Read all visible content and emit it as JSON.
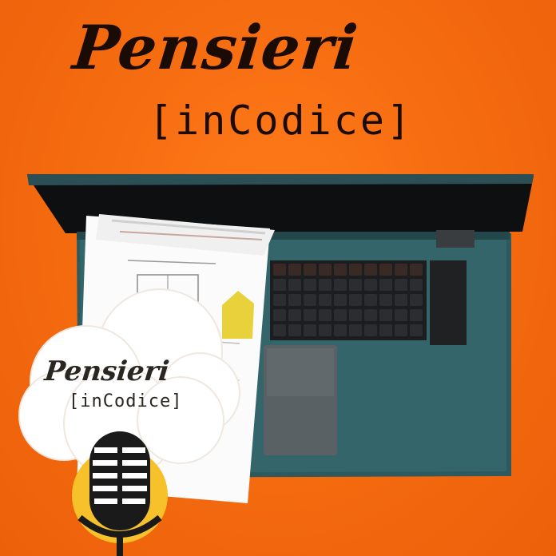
{
  "cover": {
    "title": "Pensieri",
    "subtitle": "[inCodice]"
  },
  "logo_badge": {
    "title": "Pensieri",
    "subtitle": "[inCodice]",
    "icon": "microphone-icon"
  },
  "colors": {
    "background": "#f46a0f",
    "laptop_body": "#2e5a5f",
    "screen": "#0e0f10",
    "cloud": "#ffffff",
    "mic_circle": "#f6c12a",
    "text": "#1a0c05"
  }
}
